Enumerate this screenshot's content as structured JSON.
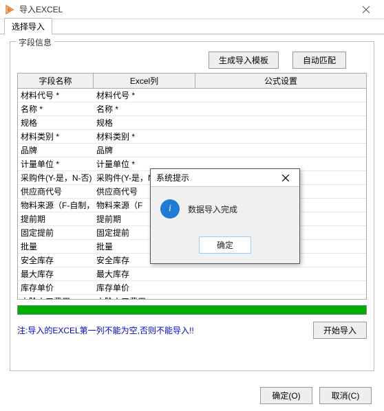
{
  "window": {
    "title": "导入EXCEL"
  },
  "tab": {
    "label": "选择导入"
  },
  "groupbox": {
    "label": "字段信息"
  },
  "toolbar": {
    "gen_template": "生成导入模板",
    "auto_match": "自动匹配",
    "start_import": "开始导入"
  },
  "grid": {
    "headers": {
      "field_name": "字段名称",
      "excel_col": "Excel列",
      "formula": "公式设置"
    },
    "rows": [
      {
        "field": "材料代号 *",
        "excel": "材料代号 *",
        "formula": ""
      },
      {
        "field": "名称 *",
        "excel": "名称 *",
        "formula": ""
      },
      {
        "field": "规格",
        "excel": "规格",
        "formula": ""
      },
      {
        "field": "材料类别 *",
        "excel": "材料类别 *",
        "formula": ""
      },
      {
        "field": "品牌",
        "excel": "品牌",
        "formula": ""
      },
      {
        "field": "计量单位 *",
        "excel": "计量单位 *",
        "formula": ""
      },
      {
        "field": "采购件(Y-是，N-否)",
        "excel": "采购件(Y-是，N-否)",
        "formula": ""
      },
      {
        "field": "供应商代号",
        "excel": "供应商代号",
        "formula": ""
      },
      {
        "field": "物料来源（F-自制，J",
        "excel": "物料来源（F",
        "formula": ""
      },
      {
        "field": "提前期",
        "excel": "提前期",
        "formula": ""
      },
      {
        "field": "固定提前",
        "excel": "固定提前",
        "formula": ""
      },
      {
        "field": "批量",
        "excel": "批量",
        "formula": ""
      },
      {
        "field": "安全库存",
        "excel": "安全库存",
        "formula": ""
      },
      {
        "field": "最大库存",
        "excel": "最大库存",
        "formula": ""
      },
      {
        "field": "库存单价",
        "excel": "库存单价",
        "formula": ""
      },
      {
        "field": "本阶人工费用",
        "excel": "本阶人工费用",
        "formula": ""
      }
    ]
  },
  "note": "注:导入的EXCEL第一列不能为空,否则不能导入!!",
  "dialog": {
    "title": "系统提示",
    "message": "数据导入完成",
    "ok": "确定"
  },
  "footer": {
    "ok": "确定(O)",
    "cancel": "取消(C)"
  }
}
